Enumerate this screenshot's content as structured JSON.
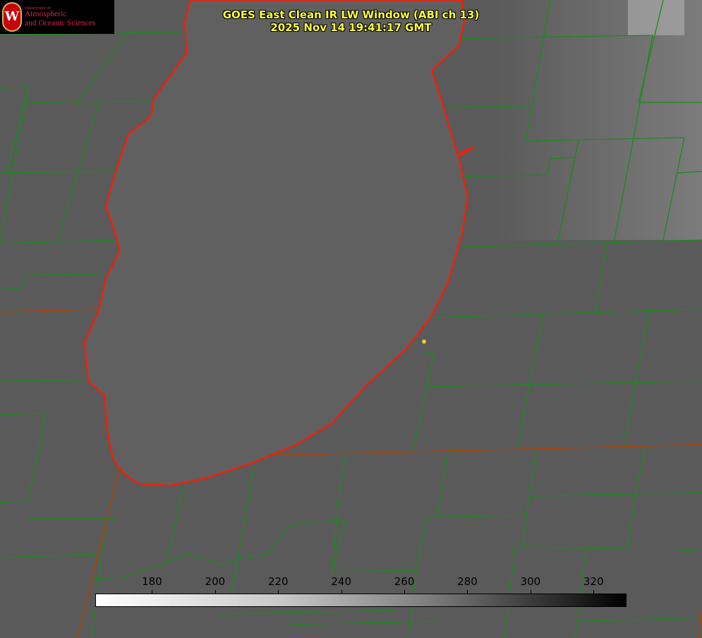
{
  "title": {
    "line1": "GOES East Clean IR LW Window (ABI ch 13)",
    "line2": "2025 Nov 14 19:41:17 GMT"
  },
  "logo": {
    "crest": "W",
    "dept": "Department of",
    "line1": "Atmospheric",
    "line2": "and Oceanic Sciences"
  },
  "colorbar": {
    "ticks": [
      "180",
      "200",
      "220",
      "240",
      "260",
      "280",
      "300",
      "320"
    ],
    "range": [
      162,
      330
    ],
    "colors": {
      "low": "#ffffff",
      "high": "#000000"
    }
  },
  "colors": {
    "shoreline": "#ff1a00",
    "county_lines": "#1a8c1a",
    "state_lines": "#b04000",
    "marker": "#e0d020"
  }
}
